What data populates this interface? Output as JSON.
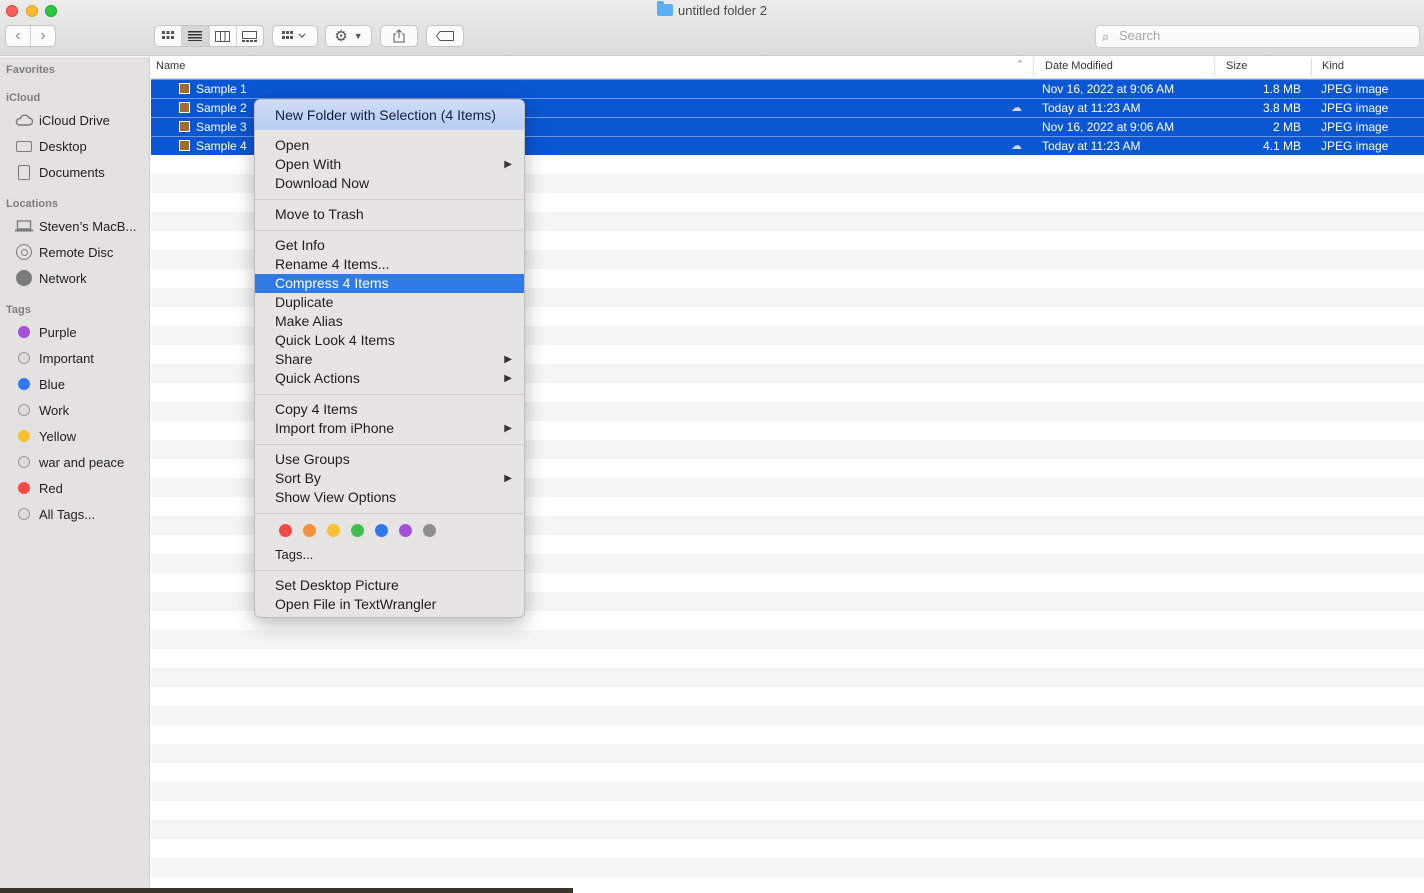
{
  "window": {
    "title": "untitled folder 2",
    "search_placeholder": "Search"
  },
  "toolbar": {
    "back_icon": "chevron-left-icon",
    "forward_icon": "chevron-right-icon",
    "views": [
      "icon-view-icon",
      "list-view-icon",
      "column-view-icon",
      "gallery-view-icon"
    ],
    "active_view": "list"
  },
  "sidebar": {
    "favorites_header": "Favorites",
    "icloud_header": "iCloud",
    "icloud_items": [
      {
        "label": "iCloud Drive",
        "icon": "cloud-icon"
      },
      {
        "label": "Desktop",
        "icon": "desktop-icon"
      },
      {
        "label": "Documents",
        "icon": "document-icon"
      }
    ],
    "locations_header": "Locations",
    "locations_items": [
      {
        "label": "Steven’s MacB...",
        "icon": "laptop-icon"
      },
      {
        "label": "Remote Disc",
        "icon": "disc-icon"
      },
      {
        "label": "Network",
        "icon": "globe-icon"
      }
    ],
    "tags_header": "Tags",
    "tags": [
      {
        "label": "Purple",
        "color": "#a550d8"
      },
      {
        "label": "Important",
        "color": ""
      },
      {
        "label": "Blue",
        "color": "#2f78f0"
      },
      {
        "label": "Work",
        "color": ""
      },
      {
        "label": "Yellow",
        "color": "#f7c131"
      },
      {
        "label": "war and peace",
        "color": ""
      },
      {
        "label": "Red",
        "color": "#f04b45"
      },
      {
        "label": "All Tags...",
        "color": ""
      }
    ]
  },
  "columns": {
    "name": "Name",
    "date": "Date Modified",
    "size": "Size",
    "kind": "Kind"
  },
  "files": [
    {
      "name": "Sample 1",
      "date": "Nov 16, 2022 at 9:06 AM",
      "size": "1.8 MB",
      "kind": "JPEG image",
      "cloud": false
    },
    {
      "name": "Sample 2",
      "date": "Today at 11:23 AM",
      "size": "3.8 MB",
      "kind": "JPEG image",
      "cloud": true
    },
    {
      "name": "Sample 3",
      "date": "Nov 16, 2022 at 9:06 AM",
      "size": "2 MB",
      "kind": "JPEG image",
      "cloud": false
    },
    {
      "name": "Sample 4",
      "date": "Today at 11:23 AM",
      "size": "4.1 MB",
      "kind": "JPEG image",
      "cloud": true
    }
  ],
  "context_menu": {
    "new_folder": "New Folder with Selection (4 Items)",
    "open": "Open",
    "open_with": "Open With",
    "download_now": "Download Now",
    "move_to_trash": "Move to Trash",
    "get_info": "Get Info",
    "rename": "Rename 4 Items...",
    "compress": "Compress 4 Items",
    "duplicate": "Duplicate",
    "make_alias": "Make Alias",
    "quick_look": "Quick Look 4 Items",
    "share": "Share",
    "quick_actions": "Quick Actions",
    "copy": "Copy 4 Items",
    "import_iphone": "Import from iPhone",
    "use_groups": "Use Groups",
    "sort_by": "Sort By",
    "show_view_options": "Show View Options",
    "tag_colors": [
      "#f04b45",
      "#f6913a",
      "#f7c131",
      "#3fc04f",
      "#2f78f0",
      "#a550d8",
      "#8e8e8e"
    ],
    "tags": "Tags...",
    "set_desktop": "Set Desktop Picture",
    "open_textwrangler": "Open File in TextWrangler"
  }
}
